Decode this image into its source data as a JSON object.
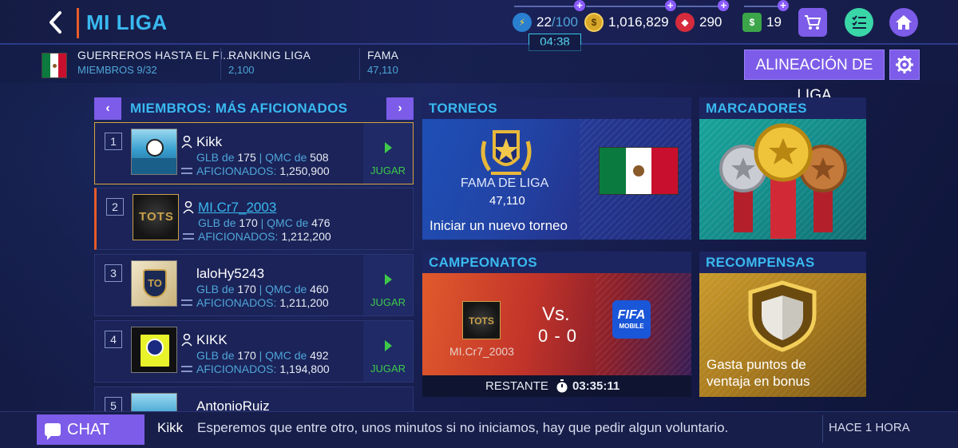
{
  "header": {
    "title": "MI LIGA",
    "energy": {
      "value": "22",
      "max": "/100",
      "timer": "04:38"
    },
    "coins": "1,016,829",
    "gems": "290",
    "cash": "19"
  },
  "league": {
    "name": "GUERREROS HASTA EL FI...",
    "members": "MIEMBROS 9/32",
    "ranking_label": "RANKING LIGA",
    "ranking_value": "2,100",
    "fame_label": "FAMA",
    "fame_value": "47,110",
    "lineup_button": "ALINEACIÓN DE LIGA"
  },
  "members_panel": {
    "title": "MIEMBROS: MÁS AFICIONADOS",
    "prev": "‹",
    "next": "›",
    "glb_label": "GLB de",
    "qmc_label": "QMC de",
    "fans_label": "AFICIONADOS:",
    "play_label": "JUGAR",
    "rows": [
      {
        "rank": "1",
        "name": "Kikk",
        "glb": "175",
        "qmc": "508",
        "fans": "1,250,900"
      },
      {
        "rank": "2",
        "name": "MI.Cr7_2003",
        "glb": "170",
        "qmc": "476",
        "fans": "1,212,200"
      },
      {
        "rank": "3",
        "name": "laloHy5243",
        "glb": "170",
        "qmc": "460",
        "fans": "1,211,200"
      },
      {
        "rank": "4",
        "name": "KIKK",
        "glb": "170",
        "qmc": "492",
        "fans": "1,194,800"
      },
      {
        "rank": "5",
        "name": "AntonioRuiz"
      }
    ]
  },
  "torneos": {
    "header": "TORNEOS",
    "fame_label": "FAMA DE LIGA",
    "fame_value": "47,110",
    "action": "Iniciar un nuevo torneo"
  },
  "marcadores": {
    "header": "MARCADORES"
  },
  "campeonatos": {
    "header": "CAMPEONATOS",
    "team": "MI.Cr7_2003",
    "vs": "Vs.",
    "score": "0 - 0",
    "opponent_logo_line1": "FIFA",
    "opponent_logo_line2": "MOBILE",
    "remaining_label": "RESTANTE",
    "remaining_time": "03:35:11"
  },
  "recompensas": {
    "header": "RECOMPENSAS",
    "text_line1": "Gasta puntos de",
    "text_line2": "ventaja en bonus"
  },
  "chat": {
    "button": "CHAT",
    "user": "Kikk",
    "message": "Esperemos que entre otro, unos minutos si no iniciamos, hay que pedir algun voluntario.",
    "time": "HACE 1 HORA"
  },
  "colors": {
    "accent_blue": "#39b9f0",
    "purple_button": "#7c5ce8",
    "play_green": "#3ec94a",
    "rank_orange": "#e85b2a"
  }
}
